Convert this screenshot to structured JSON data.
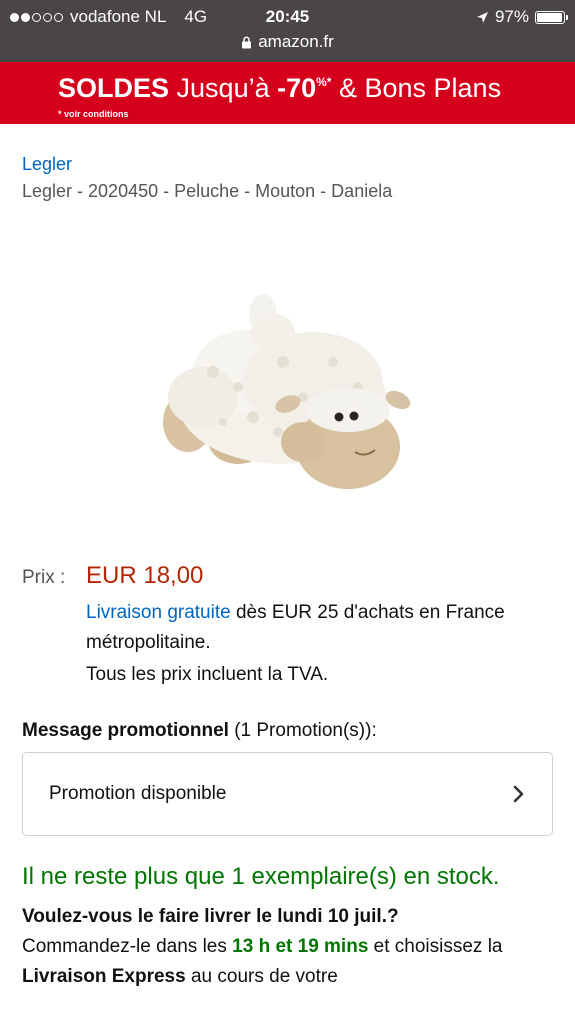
{
  "status_bar": {
    "carrier": "vodafone NL",
    "network": "4G",
    "time": "20:45",
    "battery": "97%",
    "battery_level": 0.97,
    "url": "amazon.fr"
  },
  "banner": {
    "soldes": "SOLDES",
    "jusqu": " Jusqu’à ",
    "discount": "-70",
    "discount_sup": "%*",
    "rest": " & Bons Plans",
    "note": "* voir conditions"
  },
  "product": {
    "brand": "Legler",
    "title": "Legler - 2020450 - Peluche - Mouton - Daniela",
    "image_alt": "plush-sheep"
  },
  "price": {
    "label": "Prix :",
    "value": "EUR 18,00",
    "shipping_link": "Livraison gratuite",
    "shipping_rest": " dès EUR 25 d'achats en France métropolitaine.",
    "tax_note": "Tous les prix incluent la TVA."
  },
  "promo": {
    "heading_bold": "Message promotionnel",
    "heading_rest": " (1 Promotion(s)):",
    "box_label": "Promotion disponible"
  },
  "stock": {
    "message": "Il ne reste plus que 1 exemplaire(s) en stock."
  },
  "delivery": {
    "question": "Voulez-vous le faire livrer le lundi 10 juil.?",
    "line_a": "Commandez-le dans les ",
    "countdown": "13 h et 19 mins",
    "line_b": " et choisissez la ",
    "express": "Livraison Express",
    "line_c": " au cours de votre"
  },
  "colors": {
    "status_bg": "#4a4647",
    "banner_red": "#d5001c",
    "link_blue": "#0066c0",
    "price_red": "#b12704",
    "stock_green": "#007600"
  }
}
